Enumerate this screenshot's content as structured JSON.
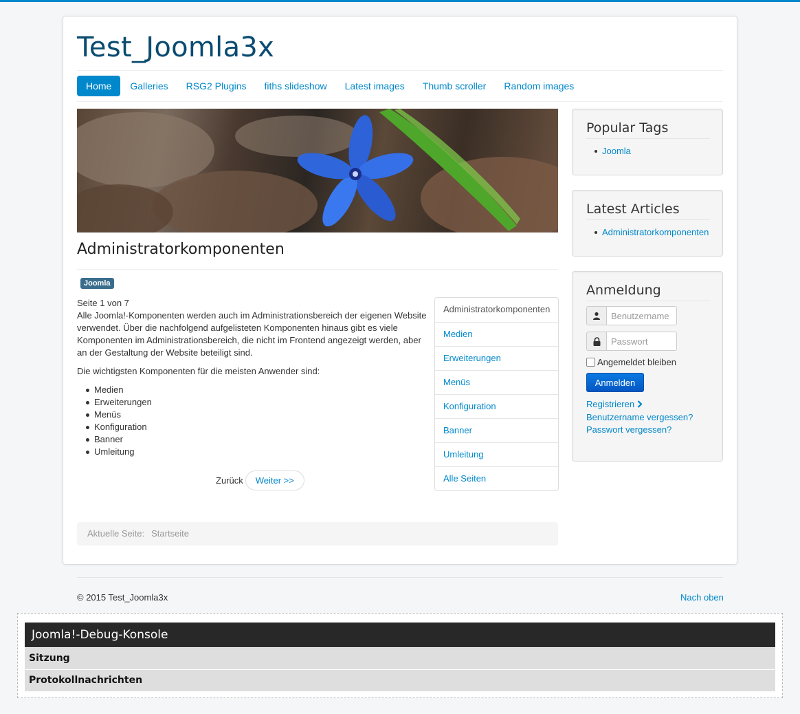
{
  "site": {
    "title": "Test_Joomla3x"
  },
  "nav": {
    "items": [
      {
        "label": "Home",
        "active": true
      },
      {
        "label": "Galleries"
      },
      {
        "label": "RSG2 Plugins"
      },
      {
        "label": "fiths slideshow"
      },
      {
        "label": "Latest images"
      },
      {
        "label": "Thumb scroller"
      },
      {
        "label": "Random images"
      }
    ]
  },
  "article": {
    "title": "Administratorkomponenten",
    "tag": "Joomla",
    "page_of": "Seite 1 von 7",
    "intro": "Alle Joomla!-Komponenten werden auch im Administrationsbereich der eigenen Website verwendet. Über die nachfolgend aufgelisteten Komponenten hinaus gibt es viele Komponenten im Administrationsbereich, die nicht im Frontend angezeigt werden, aber an der Gestaltung der Website beteiligt sind.",
    "subhead": "Die wichtigsten Komponenten für die meisten Anwender sind:",
    "components": [
      "Medien",
      "Erweiterungen",
      "Menüs",
      "Konfiguration",
      "Banner",
      "Umleitung"
    ],
    "pager_back": "Zurück",
    "pager_next": "Weiter >>"
  },
  "toc": {
    "items": [
      "Administratorkomponenten",
      "Medien",
      "Erweiterungen",
      "Menüs",
      "Konfiguration",
      "Banner",
      "Umleitung",
      "Alle Seiten"
    ]
  },
  "breadcrumb": {
    "label": "Aktuelle Seite:",
    "current": "Startseite"
  },
  "sidebar": {
    "popular_tags": {
      "title": "Popular Tags",
      "items": [
        "Joomla"
      ]
    },
    "latest_articles": {
      "title": "Latest Articles",
      "items": [
        "Administratorkomponenten"
      ]
    },
    "login": {
      "title": "Anmeldung",
      "username_placeholder": "Benutzername",
      "password_placeholder": "Passwort",
      "remember_label": "Angemeldet bleiben",
      "button_label": "Anmelden",
      "links": [
        "Registrieren",
        "Benutzername vergessen?",
        "Passwort vergessen?"
      ]
    }
  },
  "footer": {
    "copyright": "© 2015 Test_Joomla3x",
    "back_to_top": "Nach oben"
  },
  "debug": {
    "title": "Joomla!-Debug-Konsole",
    "sections": [
      "Sitzung",
      "Protokollnachrichten"
    ]
  },
  "colors": {
    "accent": "#0088cc",
    "site_title": "#0a4b70",
    "top_border": "#0088cc",
    "tag_badge": "#3a6d8c",
    "login_button": "#0a69d3",
    "debug_title_bg": "#282828"
  },
  "icons": {
    "username": "user-icon",
    "password": "lock-icon",
    "register": "chevron-right-icon"
  }
}
